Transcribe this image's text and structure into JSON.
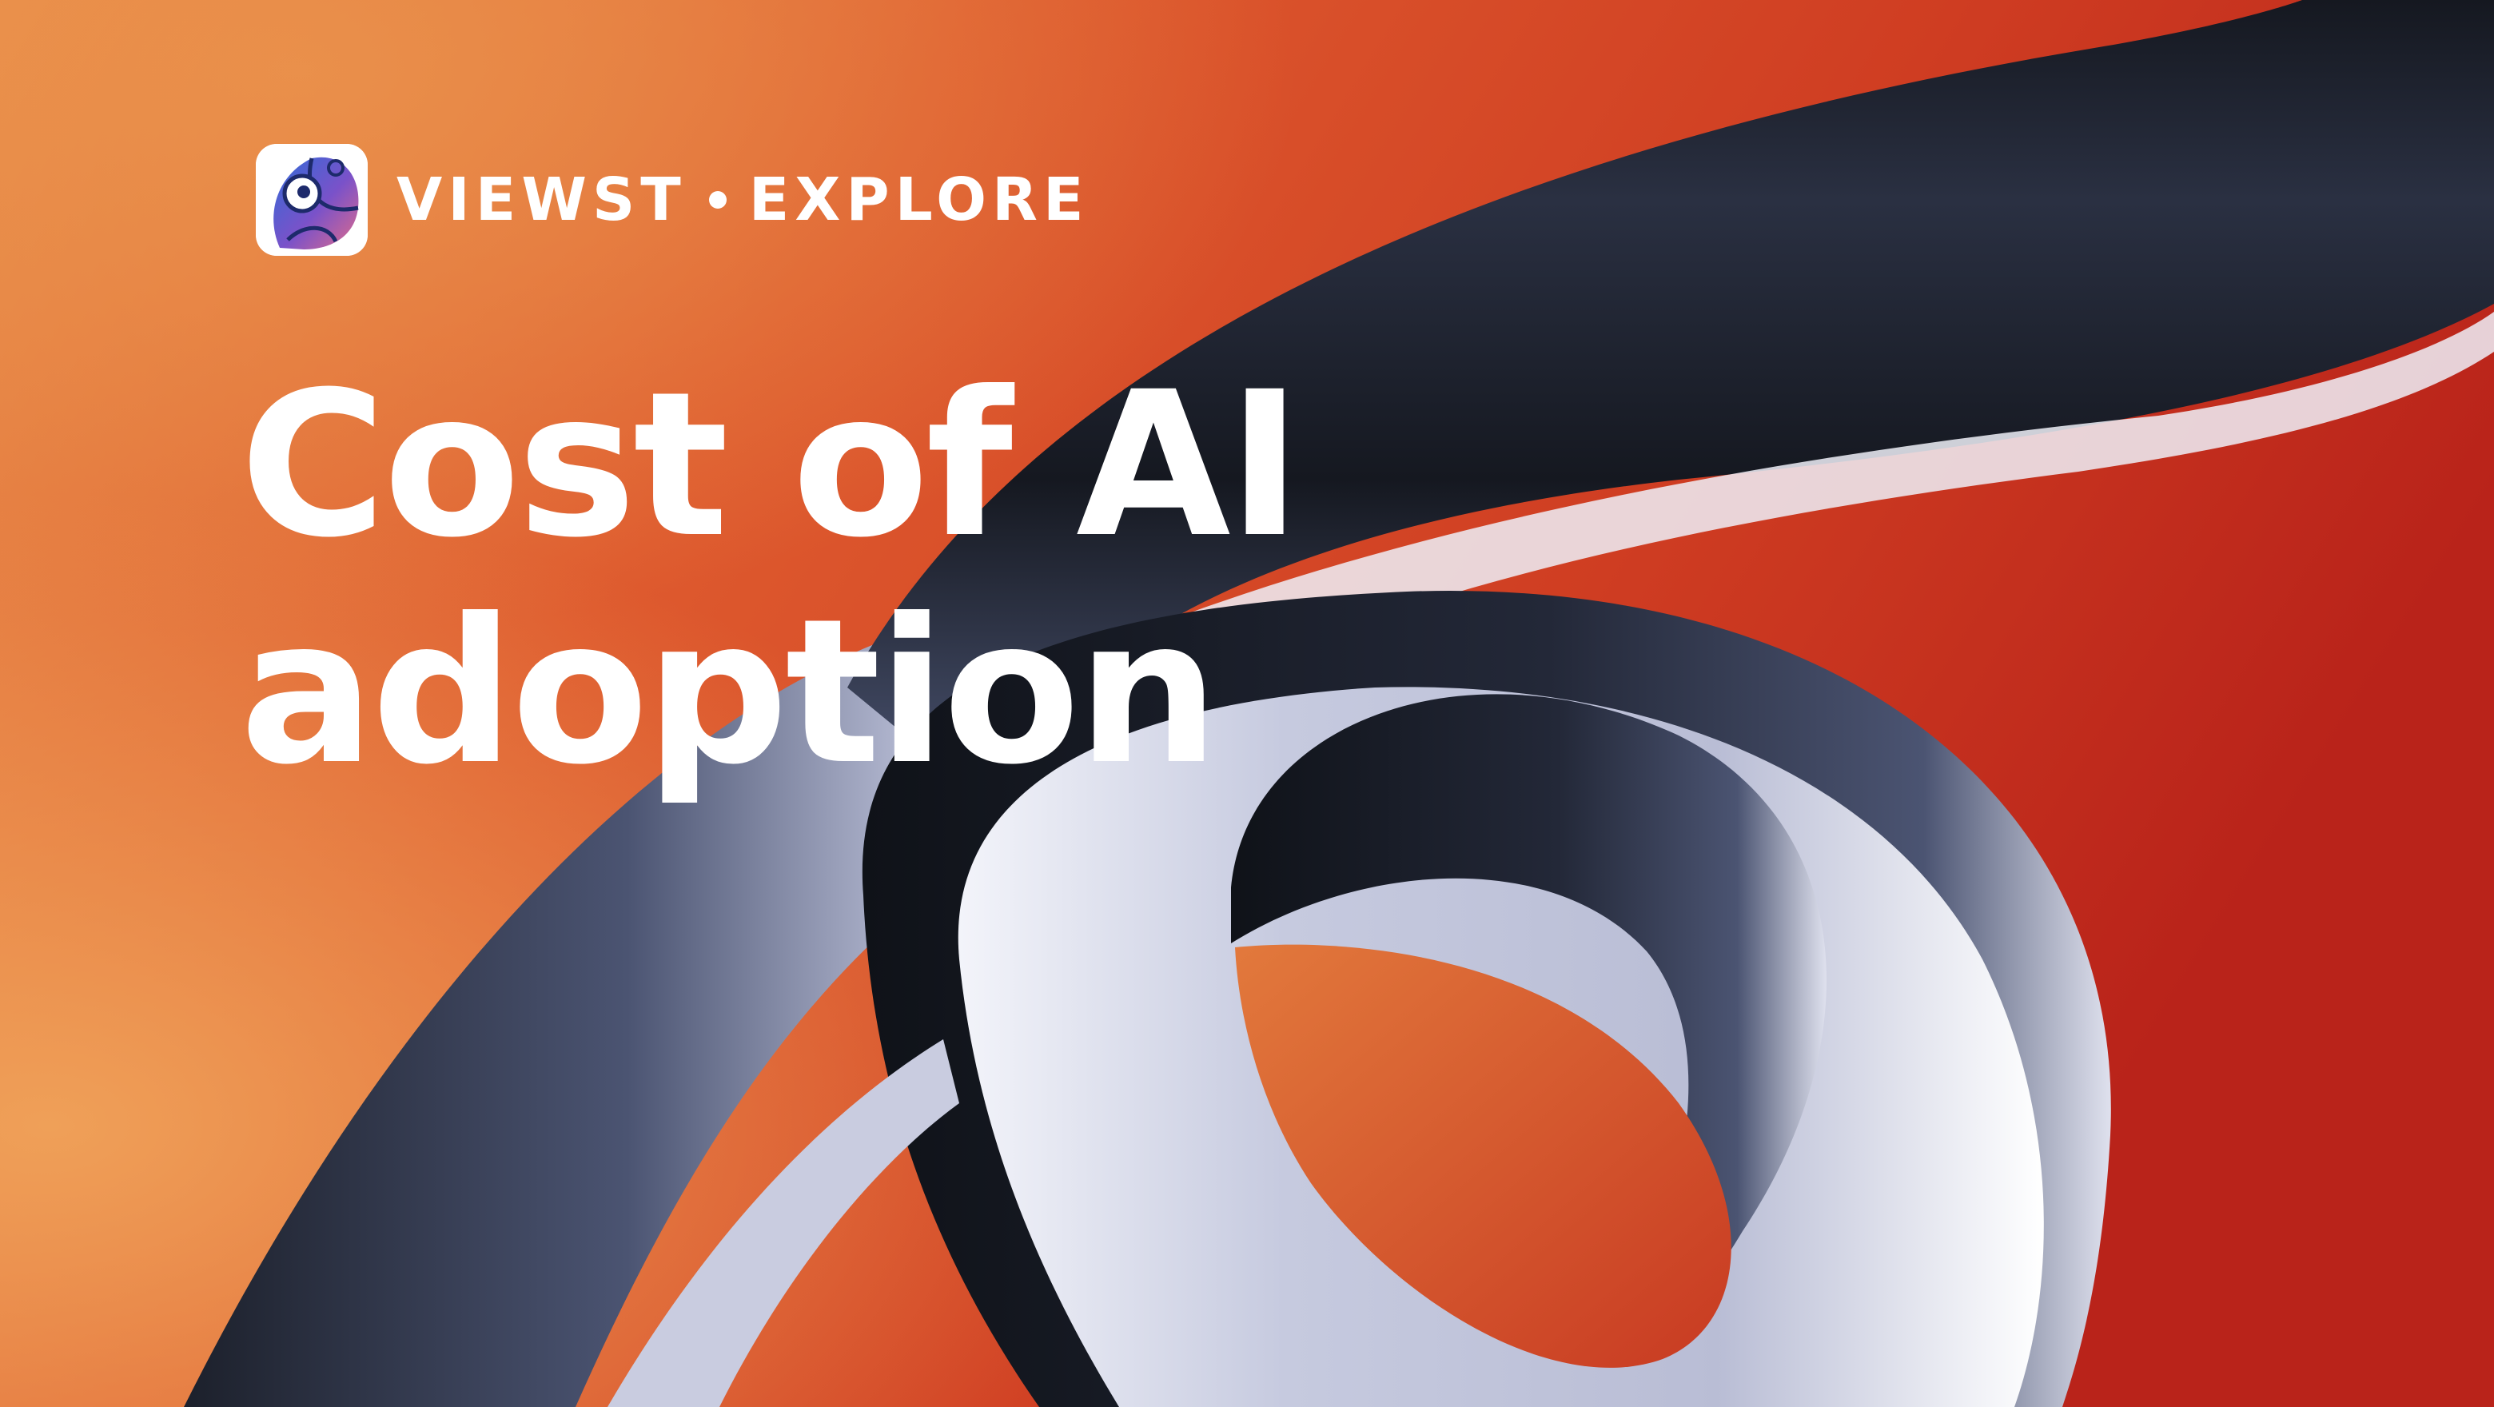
{
  "brand": {
    "name": "VIEWST",
    "section": "EXPLORE"
  },
  "headline": {
    "line1": "Cost of AI",
    "line2": "adoption"
  },
  "colors": {
    "background_orange": "#e8843f",
    "background_red": "#b9241a",
    "ribbon_dark": "#151820",
    "ribbon_slate": "#4c5573",
    "ribbon_light": "#c3c7de",
    "text": "#ffffff"
  }
}
